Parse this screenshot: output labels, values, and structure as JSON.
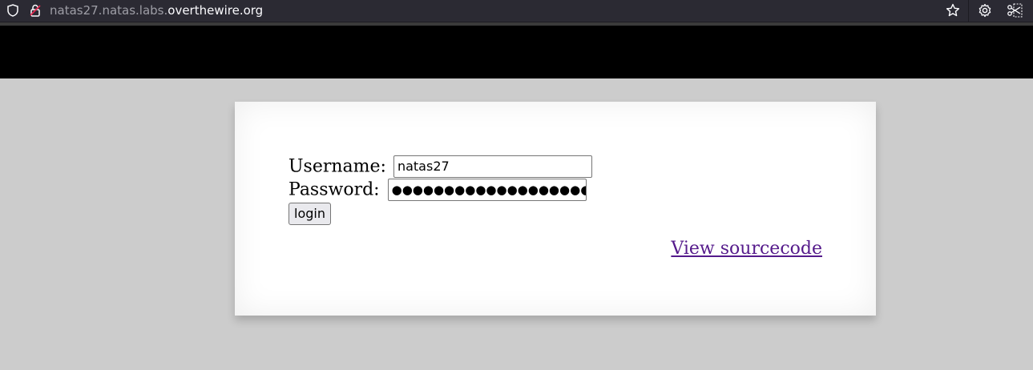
{
  "browser": {
    "url_prefix": "natas27.natas.labs.",
    "url_domain": "overthewire.org",
    "icons": [
      "shield-icon",
      "lock-icon",
      "star-icon",
      "gear-icon",
      "screenshot-icon"
    ]
  },
  "form": {
    "username_label": "Username:",
    "username_value": "natas27",
    "password_label": "Password:",
    "password_value": "●●●●●●●●●●●●●●●●●●●●",
    "login_label": "login"
  },
  "links": {
    "view_source": "View sourcecode"
  },
  "colors": {
    "page_bg": "#cccccc",
    "header_band": "#000000",
    "content_bg": "#ffffff",
    "link_visited": "#551a8b",
    "urlbar_bg": "#2b2a33"
  }
}
